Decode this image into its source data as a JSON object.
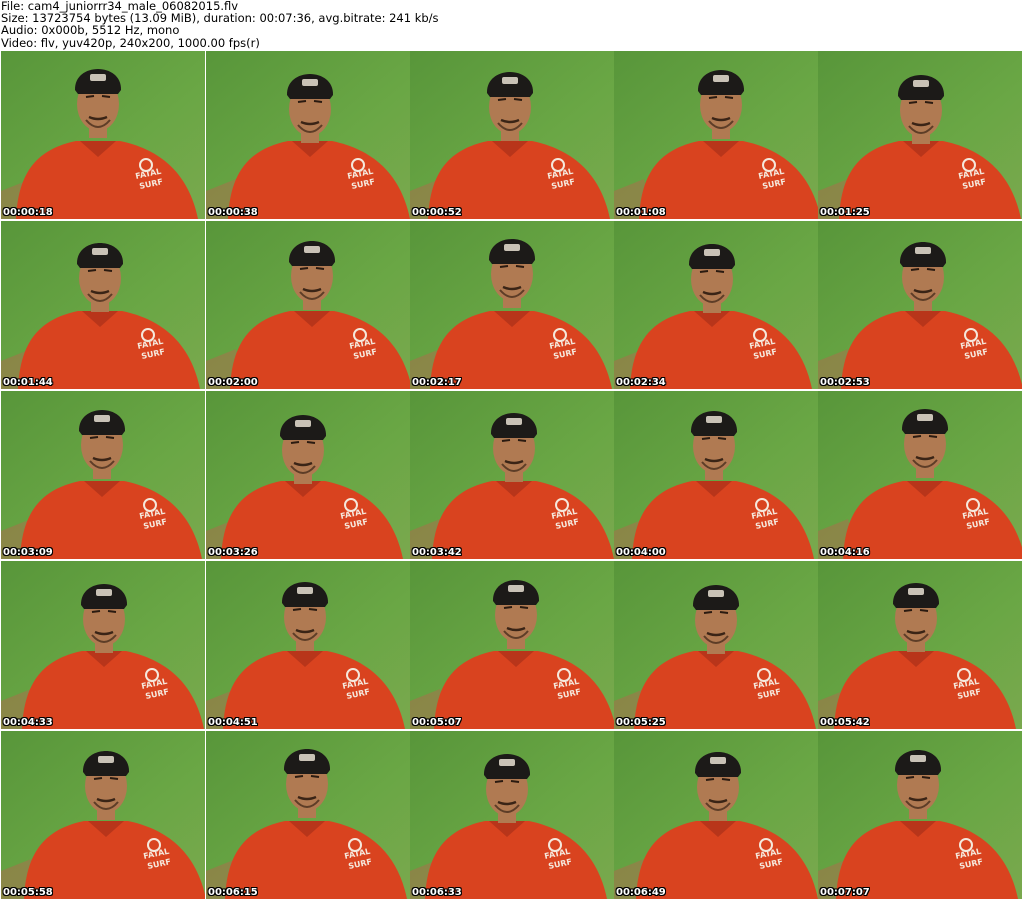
{
  "header": {
    "file_line": "File: cam4_juniorrr34_male_06082015.flv",
    "size_line": "Size: 13723754 bytes (13.09 MiB), duration: 00:07:36, avg.bitrate: 241 kb/s",
    "audio_line": "Audio: 0x000b, 5512 Hz, mono",
    "video_line": "Video: flv, yuv420p, 240x200, 1000.00 fps(r)"
  },
  "shirt_text": {
    "line1": "FATAL",
    "line2": "SURF"
  },
  "colors": {
    "wall_green": "#6aa745",
    "shirt_red": "#d9431f",
    "cap_black": "#1c1a18",
    "skin": "#b07a52"
  },
  "thumbnails": [
    {
      "timestamp": "00:00:18"
    },
    {
      "timestamp": "00:00:38"
    },
    {
      "timestamp": "00:00:52"
    },
    {
      "timestamp": "00:01:08"
    },
    {
      "timestamp": "00:01:25"
    },
    {
      "timestamp": "00:01:44"
    },
    {
      "timestamp": "00:02:00"
    },
    {
      "timestamp": "00:02:17"
    },
    {
      "timestamp": "00:02:34"
    },
    {
      "timestamp": "00:02:53"
    },
    {
      "timestamp": "00:03:09"
    },
    {
      "timestamp": "00:03:26"
    },
    {
      "timestamp": "00:03:42"
    },
    {
      "timestamp": "00:04:00"
    },
    {
      "timestamp": "00:04:16"
    },
    {
      "timestamp": "00:04:33"
    },
    {
      "timestamp": "00:04:51"
    },
    {
      "timestamp": "00:05:07"
    },
    {
      "timestamp": "00:05:25"
    },
    {
      "timestamp": "00:05:42"
    },
    {
      "timestamp": "00:05:58"
    },
    {
      "timestamp": "00:06:15"
    },
    {
      "timestamp": "00:06:33"
    },
    {
      "timestamp": "00:06:49"
    },
    {
      "timestamp": "00:07:07"
    }
  ]
}
